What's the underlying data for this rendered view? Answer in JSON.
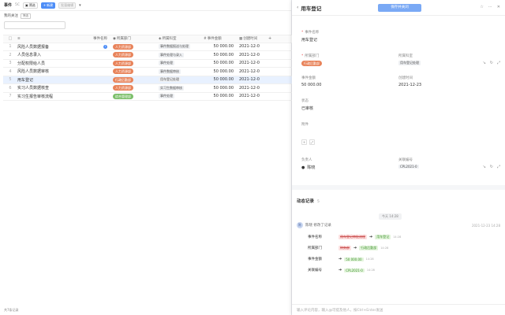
{
  "toolbar": {
    "title": "事件",
    "count": "5C",
    "btn_filter": "筛选",
    "btn_add": "新建",
    "btn_batch": "批量编辑",
    "more": "▾"
  },
  "subbar": {
    "label": "我的关注",
    "tag": "筛选"
  },
  "table": {
    "headers": [
      "事件名称",
      "所属部门",
      "所属科室",
      "事件金额",
      "创建时间"
    ],
    "rows": [
      {
        "idx": "1",
        "name": "风险人员数据报备",
        "dept": "人力资源部",
        "dept_color": "orange",
        "office": "事件数据报送与处理",
        "amount": "50 000.00",
        "date": "2021-12-0",
        "info": "i",
        "selected": false
      },
      {
        "idx": "2",
        "name": "人员信息录入",
        "dept": "人力资源部",
        "dept_color": "orange",
        "office": "事件处理与录入",
        "amount": "50 000.00",
        "date": "2021-12-0",
        "info": "",
        "selected": false
      },
      {
        "idx": "3",
        "name": "分配权限给人员",
        "dept": "人力资源部",
        "dept_color": "orange",
        "office": "事件处理",
        "amount": "50 000.00",
        "date": "2021-12-0",
        "info": "",
        "selected": false
      },
      {
        "idx": "4",
        "name": "风险人员数据审核",
        "dept": "人力资源部",
        "dept_color": "orange",
        "office": "事件数据审核",
        "amount": "50 000.00",
        "date": "2021-12-0",
        "info": "",
        "selected": false
      },
      {
        "idx": "5",
        "name": "用车登记",
        "dept": "行政后勤部",
        "dept_color": "orange",
        "office": "用车登记处理",
        "amount": "50 000.00",
        "date": "2021-12-0",
        "info": "",
        "selected": true
      },
      {
        "idx": "6",
        "name": "实习人员数据核查",
        "dept": "人力资源部",
        "dept_color": "orange",
        "office": "实习生数据审核",
        "amount": "50 000.00",
        "date": "2021-12-0",
        "info": "",
        "selected": false
      },
      {
        "idx": "7",
        "name": "实习生报告审核流程",
        "dept": "综合管理部",
        "dept_color": "green",
        "office": "事件处理",
        "amount": "50 000.00",
        "date": "2021-12-0",
        "info": "",
        "selected": false
      }
    ]
  },
  "footer": "共7条记录",
  "drawer": {
    "title": "用车登记",
    "primary_button": "保存并关闭",
    "fields": {
      "event_name_label": "事件名称",
      "event_name_value": "用车登记",
      "dept_label": "所属部门",
      "dept_value": "行政后勤部",
      "office_label": "所属科室",
      "office_value": "用车登记处理",
      "amount_label": "事件金额",
      "amount_value": "50 000.00",
      "date_label": "创建时间",
      "date_value": "2021-12-23",
      "status_label": "状态",
      "status_value": "已审核",
      "attach_label": "附件",
      "person_label": "负责人",
      "person_value": "陈晓",
      "code_label": "关联编号",
      "code_value": "CPL2021-0"
    },
    "activity": {
      "title": "动态记录",
      "count": "5",
      "time_divider": "今天 14:28",
      "author": "陈晓 修改了记录",
      "time": "2021-12-23 14:28",
      "logs": [
        {
          "key": "事件名称",
          "old": "用车登记审批流程",
          "new": "用车登记",
          "stamp": "14:28"
        },
        {
          "key": "所属部门",
          "old": "财务部",
          "new": "行政后勤部",
          "stamp": "14:28"
        },
        {
          "key": "事件金额",
          "old": "",
          "new": "50 000.00",
          "stamp": "14:28"
        },
        {
          "key": "关联编号",
          "old": "",
          "new": "CPL2021-0",
          "stamp": "14:28"
        }
      ]
    },
    "comment_placeholder": "输入评论内容，输入@可提及他人，按Ctrl+Enter发送"
  }
}
